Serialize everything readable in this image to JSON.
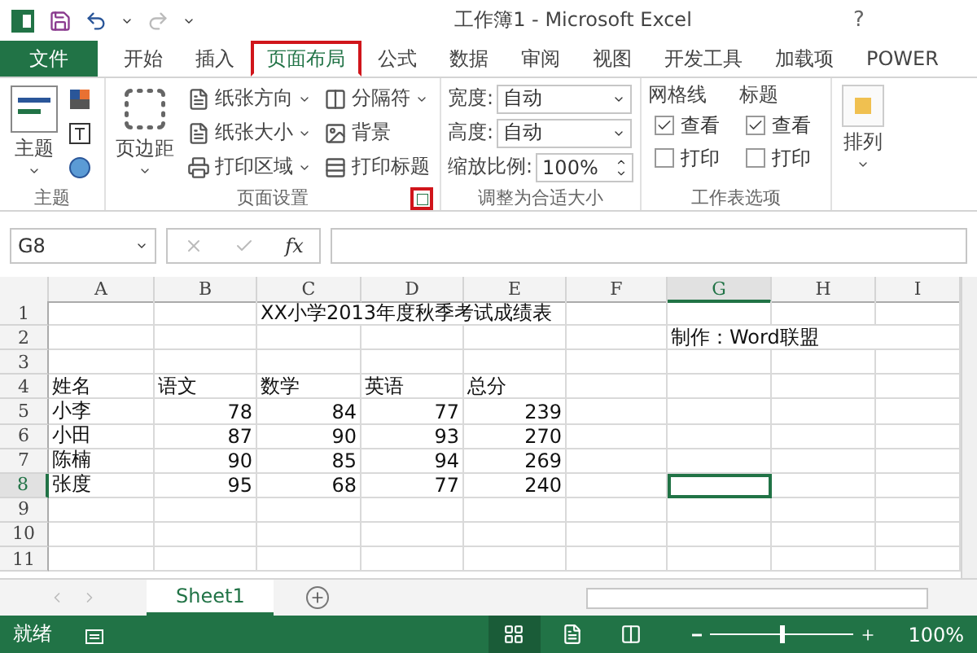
{
  "title_bar": {
    "title": "工作簿1 - Microsoft Excel",
    "help": "?",
    "redo_disabled": true
  },
  "tabs": [
    {
      "label": "文件",
      "kind": "file",
      "selected": false,
      "highlighted": false
    },
    {
      "label": "开始",
      "kind": "tab",
      "selected": false,
      "highlighted": false
    },
    {
      "label": "插入",
      "kind": "tab",
      "selected": false,
      "highlighted": false
    },
    {
      "label": "页面布局",
      "kind": "tab",
      "selected": true,
      "highlighted": true
    },
    {
      "label": "公式",
      "kind": "tab",
      "selected": false,
      "highlighted": false
    },
    {
      "label": "数据",
      "kind": "tab",
      "selected": false,
      "highlighted": false
    },
    {
      "label": "审阅",
      "kind": "tab",
      "selected": false,
      "highlighted": false
    },
    {
      "label": "视图",
      "kind": "tab",
      "selected": false,
      "highlighted": false
    },
    {
      "label": "开发工具",
      "kind": "tab",
      "selected": false,
      "highlighted": false
    },
    {
      "label": "加载项",
      "kind": "tab",
      "selected": false,
      "highlighted": false
    },
    {
      "label": "POWER",
      "kind": "tab",
      "selected": false,
      "highlighted": false
    }
  ],
  "ribbon": {
    "themes": {
      "label": "主题",
      "button": "主题"
    },
    "page_setup": {
      "label": "页面设置",
      "margins": "页边距",
      "items": [
        {
          "label": "纸张方向",
          "kind": "orientation"
        },
        {
          "label": "纸张大小",
          "kind": "size"
        },
        {
          "label": "打印区域",
          "kind": "print-area"
        },
        {
          "label": "分隔符",
          "kind": "breaks"
        },
        {
          "label": "背景",
          "kind": "background"
        },
        {
          "label": "打印标题",
          "kind": "print-titles"
        }
      ],
      "launcher_highlighted": true
    },
    "scale": {
      "label": "调整为合适大小",
      "fields": [
        {
          "label": "宽度:",
          "value": "自动",
          "kind": "dropdown"
        },
        {
          "label": "高度:",
          "value": "自动",
          "kind": "dropdown"
        },
        {
          "label": "缩放比例:",
          "value": "100%",
          "kind": "spin"
        }
      ]
    },
    "sheet_options": {
      "label": "工作表选项",
      "columns": [
        {
          "title": "网格线",
          "options": [
            {
              "label": "查看",
              "checked": true
            },
            {
              "label": "打印",
              "checked": false
            }
          ]
        },
        {
          "title": "标题",
          "options": [
            {
              "label": "查看",
              "checked": true
            },
            {
              "label": "打印",
              "checked": false
            }
          ]
        }
      ]
    },
    "arrange": {
      "label": "排列"
    }
  },
  "formula_bar": {
    "name_box": "G8",
    "function": "fx"
  },
  "sheet": {
    "columns": [
      {
        "label": "A",
        "selected": false
      },
      {
        "label": "B",
        "selected": false
      },
      {
        "label": "C",
        "selected": false
      },
      {
        "label": "D",
        "selected": false
      },
      {
        "label": "E",
        "selected": false
      },
      {
        "label": "F",
        "selected": false
      },
      {
        "label": "G",
        "selected": true
      },
      {
        "label": "H",
        "selected": false
      },
      {
        "label": "I",
        "selected": false
      }
    ],
    "rows": [
      {
        "number": "1",
        "selected": false,
        "cells": [
          "",
          "",
          "XX小学2013年度秋季考试成绩表",
          "",
          "",
          "",
          "",
          "",
          ""
        ]
      },
      {
        "number": "2",
        "selected": false,
        "cells": [
          "",
          "",
          "",
          "",
          "",
          "",
          "制作：Word联盟",
          "",
          ""
        ]
      },
      {
        "number": "3",
        "selected": false,
        "cells": [
          "",
          "",
          "",
          "",
          "",
          "",
          "",
          "",
          ""
        ]
      },
      {
        "number": "4",
        "selected": false,
        "cells": [
          "姓名",
          "语文",
          "数学",
          "英语",
          "总分",
          "",
          "",
          "",
          ""
        ]
      },
      {
        "number": "5",
        "selected": false,
        "cells": [
          "小李",
          "78",
          "84",
          "77",
          "239",
          "",
          "",
          "",
          ""
        ]
      },
      {
        "number": "6",
        "selected": false,
        "cells": [
          "小田",
          "87",
          "90",
          "93",
          "270",
          "",
          "",
          "",
          ""
        ]
      },
      {
        "number": "7",
        "selected": false,
        "cells": [
          "陈楠",
          "90",
          "85",
          "94",
          "269",
          "",
          "",
          "",
          ""
        ]
      },
      {
        "number": "8",
        "selected": true,
        "cells": [
          "张度",
          "95",
          "68",
          "77",
          "240",
          "",
          "",
          "",
          ""
        ]
      },
      {
        "number": "9",
        "selected": false,
        "cells": [
          "",
          "",
          "",
          "",
          "",
          "",
          "",
          "",
          ""
        ]
      },
      {
        "number": "10",
        "selected": false,
        "cells": [
          "",
          "",
          "",
          "",
          "",
          "",
          "",
          "",
          ""
        ]
      },
      {
        "number": "11",
        "selected": false,
        "cells": [
          "",
          "",
          "",
          "",
          "",
          "",
          "",
          "",
          ""
        ]
      }
    ]
  },
  "sheet_tabs": [
    {
      "label": "Sheet1",
      "selected": true
    }
  ],
  "status_bar": {
    "status": "就绪",
    "views": [
      {
        "kind": "normal",
        "selected": true
      },
      {
        "kind": "page-layout",
        "selected": false
      },
      {
        "kind": "page-break",
        "selected": false
      }
    ],
    "zoom": {
      "level": 0.5,
      "reading": "100%"
    }
  }
}
